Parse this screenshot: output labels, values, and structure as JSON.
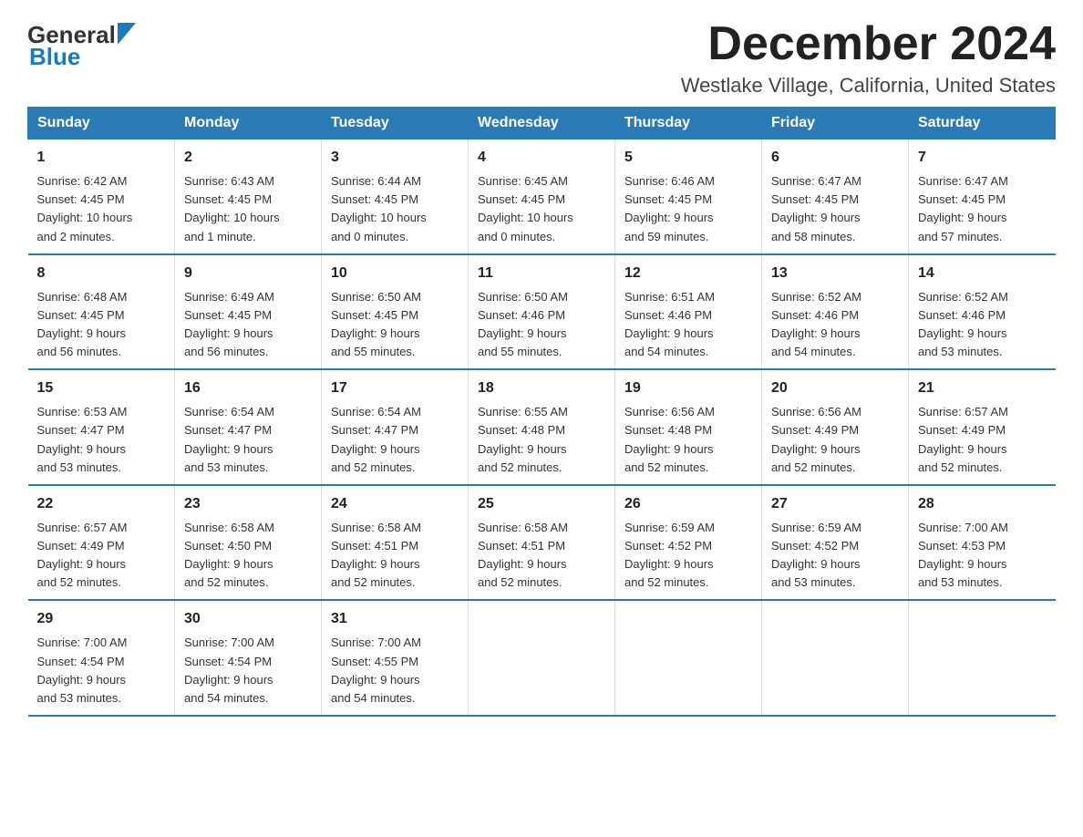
{
  "header": {
    "logo_general": "General",
    "logo_blue": "Blue",
    "title": "December 2024",
    "subtitle": "Westlake Village, California, United States"
  },
  "days_of_week": [
    "Sunday",
    "Monday",
    "Tuesday",
    "Wednesday",
    "Thursday",
    "Friday",
    "Saturday"
  ],
  "weeks": [
    [
      {
        "day": "1",
        "info": "Sunrise: 6:42 AM\nSunset: 4:45 PM\nDaylight: 10 hours\nand 2 minutes."
      },
      {
        "day": "2",
        "info": "Sunrise: 6:43 AM\nSunset: 4:45 PM\nDaylight: 10 hours\nand 1 minute."
      },
      {
        "day": "3",
        "info": "Sunrise: 6:44 AM\nSunset: 4:45 PM\nDaylight: 10 hours\nand 0 minutes."
      },
      {
        "day": "4",
        "info": "Sunrise: 6:45 AM\nSunset: 4:45 PM\nDaylight: 10 hours\nand 0 minutes."
      },
      {
        "day": "5",
        "info": "Sunrise: 6:46 AM\nSunset: 4:45 PM\nDaylight: 9 hours\nand 59 minutes."
      },
      {
        "day": "6",
        "info": "Sunrise: 6:47 AM\nSunset: 4:45 PM\nDaylight: 9 hours\nand 58 minutes."
      },
      {
        "day": "7",
        "info": "Sunrise: 6:47 AM\nSunset: 4:45 PM\nDaylight: 9 hours\nand 57 minutes."
      }
    ],
    [
      {
        "day": "8",
        "info": "Sunrise: 6:48 AM\nSunset: 4:45 PM\nDaylight: 9 hours\nand 56 minutes."
      },
      {
        "day": "9",
        "info": "Sunrise: 6:49 AM\nSunset: 4:45 PM\nDaylight: 9 hours\nand 56 minutes."
      },
      {
        "day": "10",
        "info": "Sunrise: 6:50 AM\nSunset: 4:45 PM\nDaylight: 9 hours\nand 55 minutes."
      },
      {
        "day": "11",
        "info": "Sunrise: 6:50 AM\nSunset: 4:46 PM\nDaylight: 9 hours\nand 55 minutes."
      },
      {
        "day": "12",
        "info": "Sunrise: 6:51 AM\nSunset: 4:46 PM\nDaylight: 9 hours\nand 54 minutes."
      },
      {
        "day": "13",
        "info": "Sunrise: 6:52 AM\nSunset: 4:46 PM\nDaylight: 9 hours\nand 54 minutes."
      },
      {
        "day": "14",
        "info": "Sunrise: 6:52 AM\nSunset: 4:46 PM\nDaylight: 9 hours\nand 53 minutes."
      }
    ],
    [
      {
        "day": "15",
        "info": "Sunrise: 6:53 AM\nSunset: 4:47 PM\nDaylight: 9 hours\nand 53 minutes."
      },
      {
        "day": "16",
        "info": "Sunrise: 6:54 AM\nSunset: 4:47 PM\nDaylight: 9 hours\nand 53 minutes."
      },
      {
        "day": "17",
        "info": "Sunrise: 6:54 AM\nSunset: 4:47 PM\nDaylight: 9 hours\nand 52 minutes."
      },
      {
        "day": "18",
        "info": "Sunrise: 6:55 AM\nSunset: 4:48 PM\nDaylight: 9 hours\nand 52 minutes."
      },
      {
        "day": "19",
        "info": "Sunrise: 6:56 AM\nSunset: 4:48 PM\nDaylight: 9 hours\nand 52 minutes."
      },
      {
        "day": "20",
        "info": "Sunrise: 6:56 AM\nSunset: 4:49 PM\nDaylight: 9 hours\nand 52 minutes."
      },
      {
        "day": "21",
        "info": "Sunrise: 6:57 AM\nSunset: 4:49 PM\nDaylight: 9 hours\nand 52 minutes."
      }
    ],
    [
      {
        "day": "22",
        "info": "Sunrise: 6:57 AM\nSunset: 4:49 PM\nDaylight: 9 hours\nand 52 minutes."
      },
      {
        "day": "23",
        "info": "Sunrise: 6:58 AM\nSunset: 4:50 PM\nDaylight: 9 hours\nand 52 minutes."
      },
      {
        "day": "24",
        "info": "Sunrise: 6:58 AM\nSunset: 4:51 PM\nDaylight: 9 hours\nand 52 minutes."
      },
      {
        "day": "25",
        "info": "Sunrise: 6:58 AM\nSunset: 4:51 PM\nDaylight: 9 hours\nand 52 minutes."
      },
      {
        "day": "26",
        "info": "Sunrise: 6:59 AM\nSunset: 4:52 PM\nDaylight: 9 hours\nand 52 minutes."
      },
      {
        "day": "27",
        "info": "Sunrise: 6:59 AM\nSunset: 4:52 PM\nDaylight: 9 hours\nand 53 minutes."
      },
      {
        "day": "28",
        "info": "Sunrise: 7:00 AM\nSunset: 4:53 PM\nDaylight: 9 hours\nand 53 minutes."
      }
    ],
    [
      {
        "day": "29",
        "info": "Sunrise: 7:00 AM\nSunset: 4:54 PM\nDaylight: 9 hours\nand 53 minutes."
      },
      {
        "day": "30",
        "info": "Sunrise: 7:00 AM\nSunset: 4:54 PM\nDaylight: 9 hours\nand 54 minutes."
      },
      {
        "day": "31",
        "info": "Sunrise: 7:00 AM\nSunset: 4:55 PM\nDaylight: 9 hours\nand 54 minutes."
      },
      {
        "day": "",
        "info": ""
      },
      {
        "day": "",
        "info": ""
      },
      {
        "day": "",
        "info": ""
      },
      {
        "day": "",
        "info": ""
      }
    ]
  ]
}
